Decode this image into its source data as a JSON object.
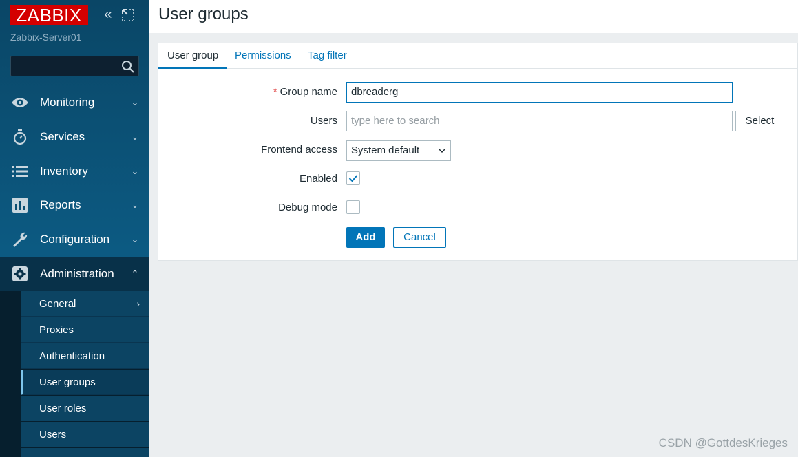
{
  "sidebar": {
    "logo": "ZABBIX",
    "server_name": "Zabbix-Server01",
    "search_value": "",
    "menu": [
      {
        "label": "Monitoring",
        "icon": "eye-icon",
        "chevron": "⌄"
      },
      {
        "label": "Services",
        "icon": "stopwatch-icon",
        "chevron": "⌄"
      },
      {
        "label": "Inventory",
        "icon": "list-icon",
        "chevron": "⌄"
      },
      {
        "label": "Reports",
        "icon": "bar-chart-icon",
        "chevron": "⌄"
      },
      {
        "label": "Configuration",
        "icon": "wrench-icon",
        "chevron": "⌄"
      },
      {
        "label": "Administration",
        "icon": "gear-icon",
        "chevron": "⌃"
      }
    ],
    "submenu": [
      {
        "label": "General",
        "chevron": "›"
      },
      {
        "label": "Proxies"
      },
      {
        "label": "Authentication"
      },
      {
        "label": "User groups"
      },
      {
        "label": "User roles"
      },
      {
        "label": "Users"
      }
    ]
  },
  "page": {
    "title": "User groups"
  },
  "tabs": [
    "User group",
    "Permissions",
    "Tag filter"
  ],
  "form": {
    "group_name_label": "Group name",
    "group_name_value": "dbreaderg",
    "users_label": "Users",
    "users_placeholder": "type here to search",
    "select_button": "Select",
    "frontend_access_label": "Frontend access",
    "frontend_access_value": "System default",
    "enabled_label": "Enabled",
    "enabled_checked": true,
    "debug_mode_label": "Debug mode",
    "debug_mode_checked": false,
    "add_button": "Add",
    "cancel_button": "Cancel"
  },
  "watermark": "CSDN @GottdesKrieges",
  "colors": {
    "brand_red": "#d40000",
    "accent_blue": "#0275b8",
    "sidebar_blue": "#0c5a82"
  }
}
